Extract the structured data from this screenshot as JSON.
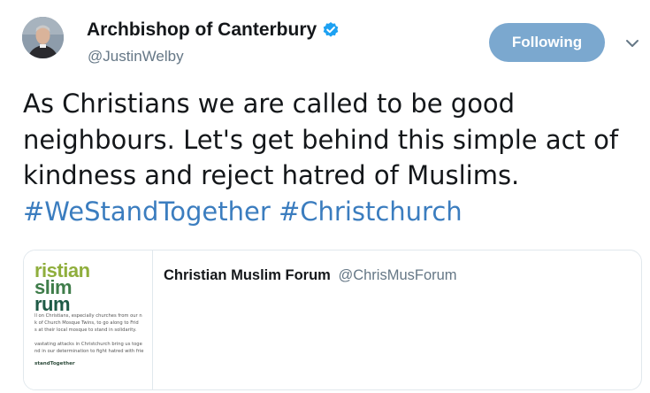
{
  "author": {
    "display_name": "Archbishop of Canterbury",
    "handle": "@JustinWelby",
    "verified": true,
    "avatar_icon": "user-avatar"
  },
  "actions": {
    "follow_label": "Following",
    "follow_color": "#7ba8cf",
    "menu_icon": "chevron-down-icon"
  },
  "tweet": {
    "text": "As Christians we are called to be good neighbours. Let's get behind this simple act of kindness and reject hatred of Muslims.",
    "hashtags": [
      "#WeStandTogether",
      "#Christchurch"
    ],
    "hashtag_color": "#3b7dbf"
  },
  "quoted": {
    "name": "Christian Muslim Forum",
    "handle": "@ChrisMusForum",
    "thumb": {
      "logo_lines": [
        "ristian",
        "slim",
        "rum"
      ],
      "body_lines": [
        "ll on Christians, especially churches from our n",
        "k of Church Mosque Twins, to go along to Frid",
        "s at their local mosque to stand in solidarity.",
        "",
        "vastating attacks in Christchurch bring us toge",
        "nd in our determination to fight hatred with frie"
      ],
      "tag": "standTogether"
    }
  }
}
